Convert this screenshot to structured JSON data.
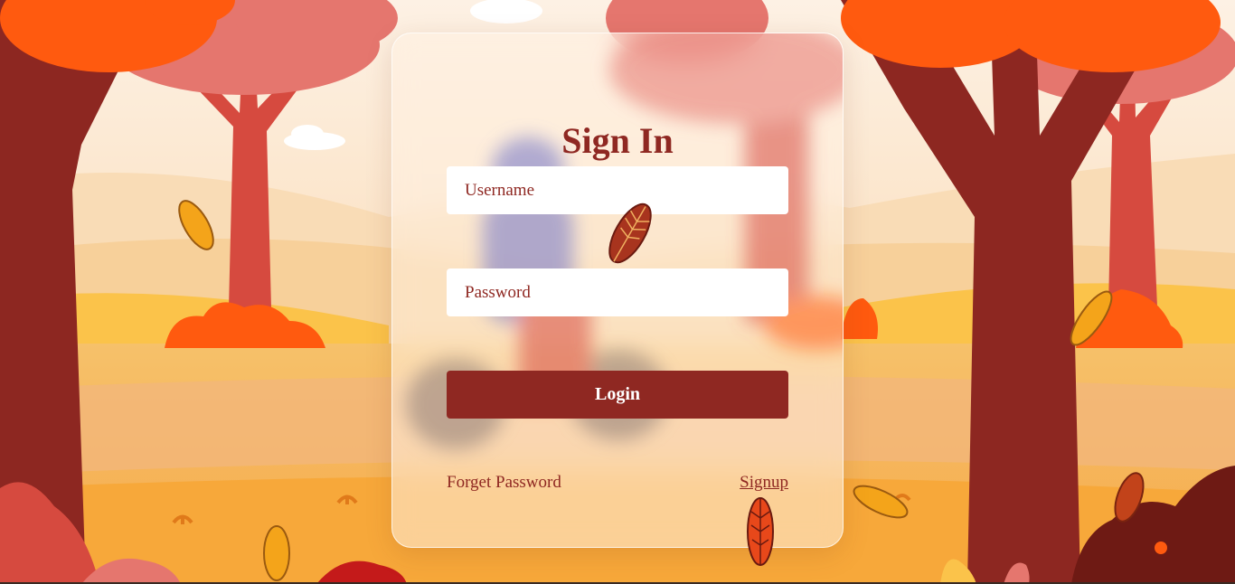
{
  "login_form": {
    "title": "Sign In",
    "username_placeholder": "Username",
    "password_placeholder": "Password",
    "login_label": "Login",
    "forget_password_label": "Forget Password",
    "signup_label": "Signup"
  },
  "colors": {
    "brand": "#8f2822",
    "sky": "#fde9d3",
    "trunk_dark": "#8d2721",
    "trunk_light": "#d64a3f",
    "foliage_orange": "#ff5a0f",
    "foliage_pink": "#e5766e",
    "hill_yellow": "#fbc34a"
  }
}
